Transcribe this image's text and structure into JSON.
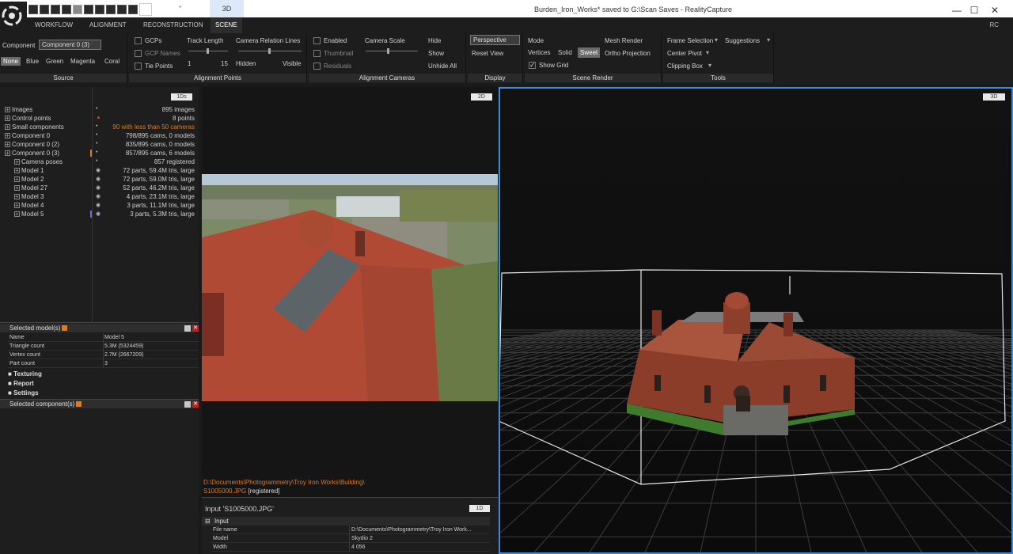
{
  "window": {
    "title": "Burden_Iron_Works* saved to G:\\Scan Saves - RealityCapture",
    "tab_3d": "3D",
    "dots": "''",
    "rc": "RC",
    "minimize": "—",
    "maximize": "☐",
    "close": "✕"
  },
  "menu": [
    "WORKFLOW",
    "ALIGNMENT",
    "RECONSTRUCTION",
    "SCENE"
  ],
  "ribbon": {
    "source": {
      "label": "Source",
      "component_label": "Component",
      "component_value": "Component 0 (3)",
      "colors": [
        "None",
        "Blue",
        "Green",
        "Magenta",
        "Coral"
      ]
    },
    "alignment_points": {
      "label": "Alignment Points",
      "gcps": "GCPs",
      "gcp_names": "GCP Names",
      "tie_points": "Tie Points",
      "track_length": "Track Length",
      "track_min": "1",
      "track_max": "15",
      "camera_relation_lines": "Camera Relation Lines",
      "hidden": "Hidden",
      "visible": "Visible"
    },
    "alignment_cameras": {
      "label": "Alignment Cameras",
      "enabled": "Enabled",
      "thumbnail": "Thumbnail",
      "residuals": "Residuals",
      "camera_scale": "Camera Scale",
      "hide": "Hide",
      "show": "Show",
      "unhide_all": "Unhide All"
    },
    "display": {
      "label": "Display",
      "projection": "Perspective",
      "reset_view": "Reset View"
    },
    "scene_render": {
      "label": "Scene Render",
      "mode": "Mode",
      "vertices": "Vertices",
      "solid": "Solid",
      "sweet": "Sweet",
      "show_grid": "Show Grid",
      "mesh_render": "Mesh Render",
      "ortho_projection": "Ortho Projection"
    },
    "tools": {
      "label": "Tools",
      "frame_selection": "Frame Selection",
      "suggestions": "Suggestions",
      "center_pivot": "Center Pivot",
      "clipping_box": "Clipping Box"
    }
  },
  "tree": {
    "ids_button": "1Ds",
    "items": [
      {
        "label": "Images",
        "value": "895 images",
        "indent": 0
      },
      {
        "label": "Control points",
        "value": "8 points",
        "indent": 0
      },
      {
        "label": "Small components",
        "value": "90 with less than 50 cameras",
        "indent": 0
      },
      {
        "label": "Component 0",
        "value": "798/895 cams, 0 models",
        "indent": 0
      },
      {
        "label": "Component 0 (2)",
        "value": "835/895 cams, 0 models",
        "indent": 0
      },
      {
        "label": "Component 0 (3)",
        "value": "857/895 cams, 6 models",
        "indent": 0
      },
      {
        "label": "Camera poses",
        "value": "857 registered",
        "indent": 1
      },
      {
        "label": "Model 1",
        "value": "72 parts, 59.4M tris, large",
        "indent": 1
      },
      {
        "label": "Model 2",
        "value": "72 parts, 59.0M tris, large",
        "indent": 1
      },
      {
        "label": "Model 27",
        "value": "52 parts, 46.2M tris, large",
        "indent": 1
      },
      {
        "label": "Model 3",
        "value": "4 parts, 23.1M tris, large",
        "indent": 1
      },
      {
        "label": "Model 4",
        "value": "3 parts, 11.1M tris, large",
        "indent": 1
      },
      {
        "label": "Model 5",
        "value": "3 parts, 5.3M tris, large",
        "indent": 1
      }
    ]
  },
  "selected_model": {
    "title": "Selected model(s)",
    "rows": [
      {
        "k": "Name",
        "v": "Model 5"
      },
      {
        "k": "Triangle count",
        "v": "5.3M (5324459)"
      },
      {
        "k": "Vertex count",
        "v": "2.7M (2667209)"
      },
      {
        "k": "Part count",
        "v": "3"
      }
    ],
    "sections": [
      "Texturing",
      "Report",
      "Settings"
    ]
  },
  "selected_component": {
    "title": "Selected component(s)"
  },
  "view2d": {
    "badge": "2D",
    "path": "D:\\Documents\\Photogrammetry\\Troy Iron Works\\Building\\",
    "file": "S1005000.JPG",
    "status": "[registered]"
  },
  "input_panel": {
    "title": "Input 'S1005000.JPG'",
    "badge": "1D",
    "section": "Input",
    "rows": [
      {
        "k": "File name",
        "v": "D:\\Documents\\Photogrammetry\\Troy Iron Work..."
      },
      {
        "k": "Model",
        "v": "Skydio 2"
      },
      {
        "k": "Width",
        "v": "4 056"
      }
    ]
  },
  "view3d": {
    "badge": "3D"
  }
}
